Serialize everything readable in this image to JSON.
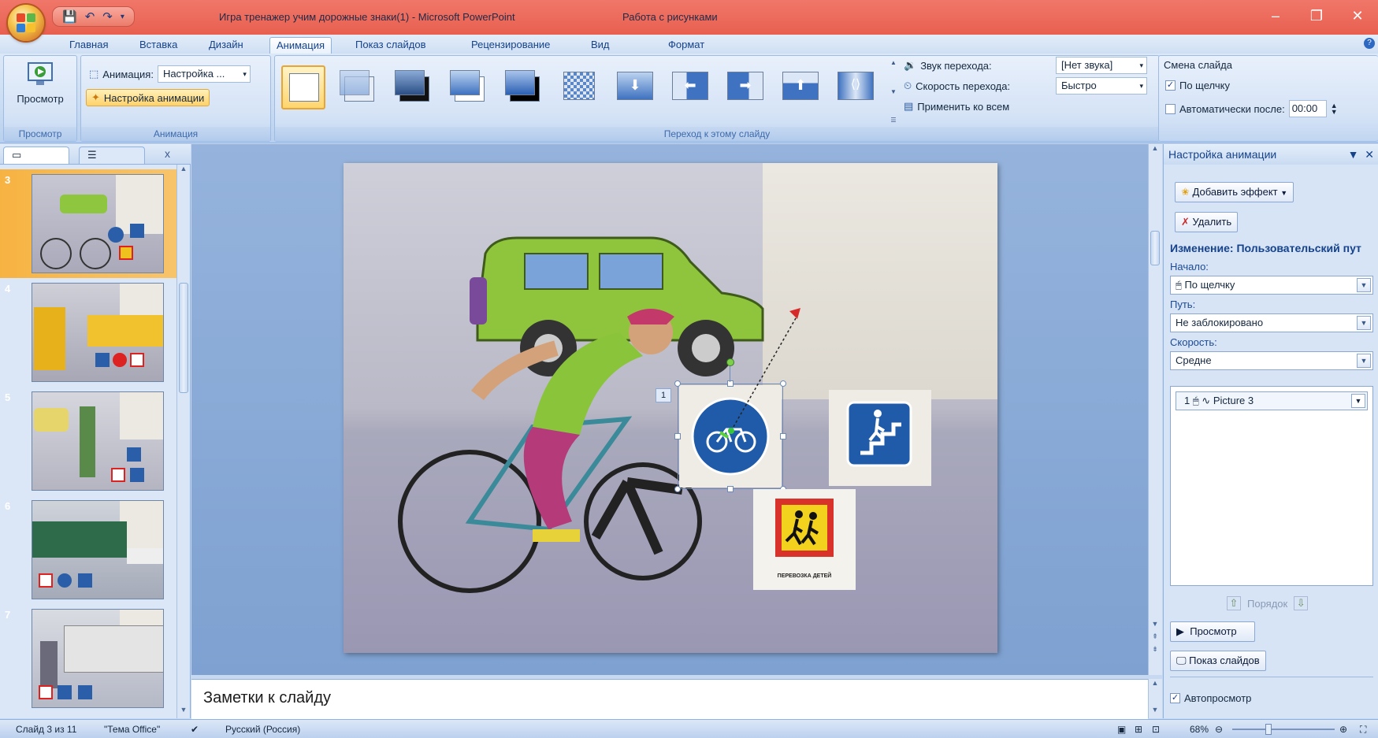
{
  "titlebar": {
    "title": "Игра тренажер учим дорожные знаки(1) - Microsoft PowerPoint",
    "context_title": "Работа с рисунками",
    "minimize": "–",
    "maximize": "❐",
    "close": "✕"
  },
  "qat": {
    "save_icon": "save-icon",
    "undo_icon": "undo-icon",
    "redo_icon": "redo-icon"
  },
  "tabs": [
    {
      "label": "Главная"
    },
    {
      "label": "Вставка"
    },
    {
      "label": "Дизайн"
    },
    {
      "label": "Анимация"
    },
    {
      "label": "Показ слайдов"
    },
    {
      "label": "Рецензирование"
    },
    {
      "label": "Вид"
    },
    {
      "label": "Формат"
    }
  ],
  "ribbon": {
    "preview": {
      "button_label": "Просмотр",
      "group_label": "Просмотр"
    },
    "animation": {
      "group_label": "Анимация",
      "animation_label": "Анимация:",
      "animation_value": "Настройка ...",
      "custom_animation_label": "Настройка анимации"
    },
    "transition": {
      "group_label": "Переход к этому слайду",
      "sound_label": "Звук перехода:",
      "sound_value": "[Нет звука]",
      "speed_label": "Скорость перехода:",
      "speed_value": "Быстро",
      "apply_all_label": "Применить ко всем"
    },
    "advance": {
      "title": "Смена слайда",
      "on_click_label": "По щелчку",
      "on_click_checked": "✓",
      "auto_after_label": "Автоматически после:",
      "auto_after_value": "00:00"
    }
  },
  "slides_panel": {
    "close": "x",
    "thumbnails": [
      {
        "number": "3",
        "selected": true
      },
      {
        "number": "4",
        "selected": false
      },
      {
        "number": "5",
        "selected": false
      },
      {
        "number": "6",
        "selected": false
      },
      {
        "number": "7",
        "selected": false
      }
    ]
  },
  "slide": {
    "animation_tag": "1",
    "sign_caption": "ПЕРЕВОЗКА ДЕТЕЙ"
  },
  "notes": {
    "placeholder": "Заметки к слайду"
  },
  "task_pane": {
    "title": "Настройка анимации",
    "add_effect": "Добавить эффект",
    "remove": "Удалить",
    "change_title": "Изменение: Пользовательский пут",
    "start_label": "Начало:",
    "start_value": "По щелчку",
    "path_label": "Путь:",
    "path_value": "Не заблокировано",
    "speed_label": "Скорость:",
    "speed_value": "Средне",
    "list_item": {
      "index": "1",
      "name": "Picture 3"
    },
    "order_label": "Порядок",
    "play_label": "Просмотр",
    "slideshow_label": "Показ слайдов",
    "autopreview_label": "Автопросмотр",
    "autopreview_checked": "✓"
  },
  "statusbar": {
    "slide_info": "Слайд 3 из 11",
    "theme": "\"Тема Office\"",
    "language": "Русский (Россия)",
    "zoom": "68%"
  },
  "colors": {
    "titlebar": "#e8604f",
    "ribbon": "#c9dcf3",
    "selected_thumb": "#f7b342",
    "accent_blue": "#15428b"
  }
}
